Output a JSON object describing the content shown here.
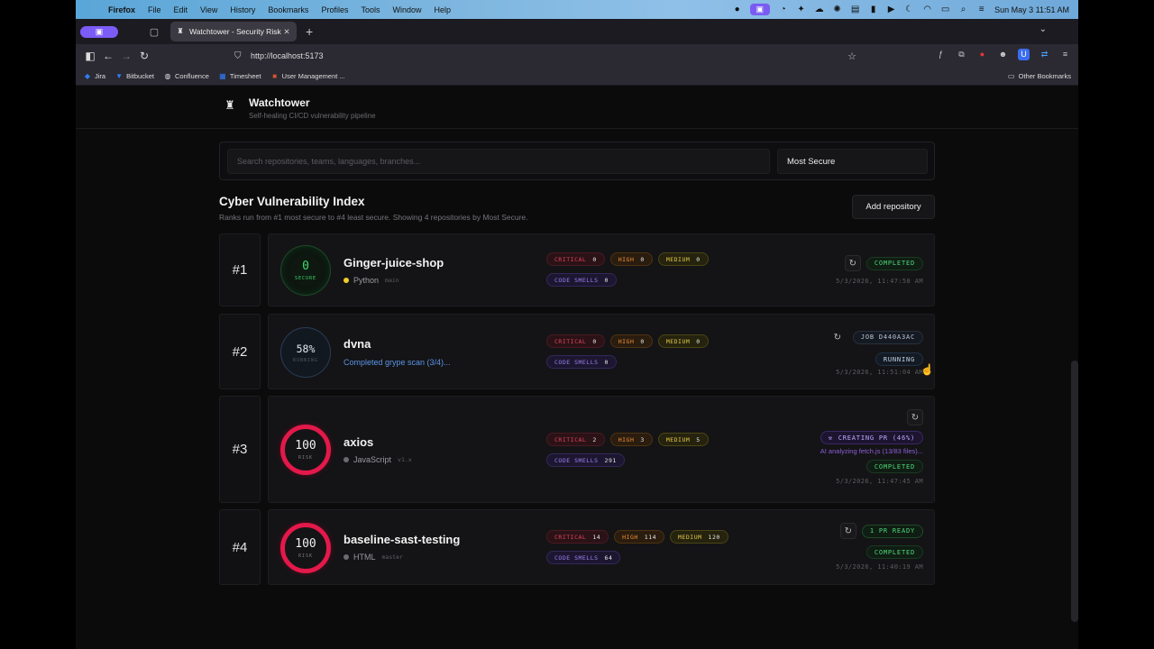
{
  "menubar": {
    "app": "Firefox",
    "items": [
      "File",
      "Edit",
      "View",
      "History",
      "Bookmarks",
      "Profiles",
      "Tools",
      "Window",
      "Help"
    ],
    "clock": "Sun May 3  11:51 AM"
  },
  "browser": {
    "tab_title": "Watchtower - Security Risk Lea",
    "url": "http://localhost:5173",
    "bookmarks": [
      "Jira",
      "Bitbucket",
      "Confluence",
      "Timesheet",
      "User Management ..."
    ],
    "other_bookmarks": "Other Bookmarks"
  },
  "app": {
    "title": "Watchtower",
    "subtitle": "Self-healing CI/CD vulnerability pipeline"
  },
  "search": {
    "placeholder": "Search repositories, teams, languages, branches...",
    "sort_value": "Most Secure"
  },
  "index": {
    "title": "Cyber Vulnerability Index",
    "subtitle": "Ranks run from #1 most secure to #4 least secure. Showing 4 repositories by Most Secure.",
    "add_button": "Add repository"
  },
  "repos": [
    {
      "rank": "#1",
      "score": "0",
      "score_label": "SECURE",
      "name": "Ginger-juice-shop",
      "language": "Python",
      "branch": "main",
      "lang_color": "#f2cc2c",
      "critical": "0",
      "high": "0",
      "medium": "0",
      "code_smells": "0",
      "status": "COMPLETED",
      "timestamp": "5/3/2026, 11:47:58 AM"
    },
    {
      "rank": "#2",
      "score": "58%",
      "score_label": "RUNNING",
      "name": "dvna",
      "progress_text": "Completed grype scan (3/4)...",
      "critical": "0",
      "high": "0",
      "medium": "0",
      "code_smells": "0",
      "job": "JOB D440A3AC",
      "status": "RUNNING",
      "timestamp": "5/3/2026, 11:51:04 AM"
    },
    {
      "rank": "#3",
      "score": "100",
      "score_label": "RISK",
      "name": "axios",
      "language": "JavaScript",
      "branch": "v1.x",
      "lang_color": "#6b6b70",
      "critical": "2",
      "high": "3",
      "medium": "5",
      "code_smells": "291",
      "pr_status": "CREATING PR (46%)",
      "ai_note": "AI analyzing fetch.js (13/83 files)...",
      "status": "COMPLETED",
      "timestamp": "5/3/2026, 11:47:45 AM"
    },
    {
      "rank": "#4",
      "score": "100",
      "score_label": "RISK",
      "name": "baseline-sast-testing",
      "language": "HTML",
      "branch": "master",
      "lang_color": "#6b6b70",
      "critical": "14",
      "high": "114",
      "medium": "120",
      "code_smells": "64",
      "pr_ready": "1 PR READY",
      "status": "COMPLETED",
      "timestamp": "5/3/2026, 11:40:19 AM"
    }
  ],
  "labels": {
    "critical": "CRITICAL",
    "high": "HIGH",
    "medium": "MEDIUM",
    "code_smells": "CODE SMELLS"
  }
}
